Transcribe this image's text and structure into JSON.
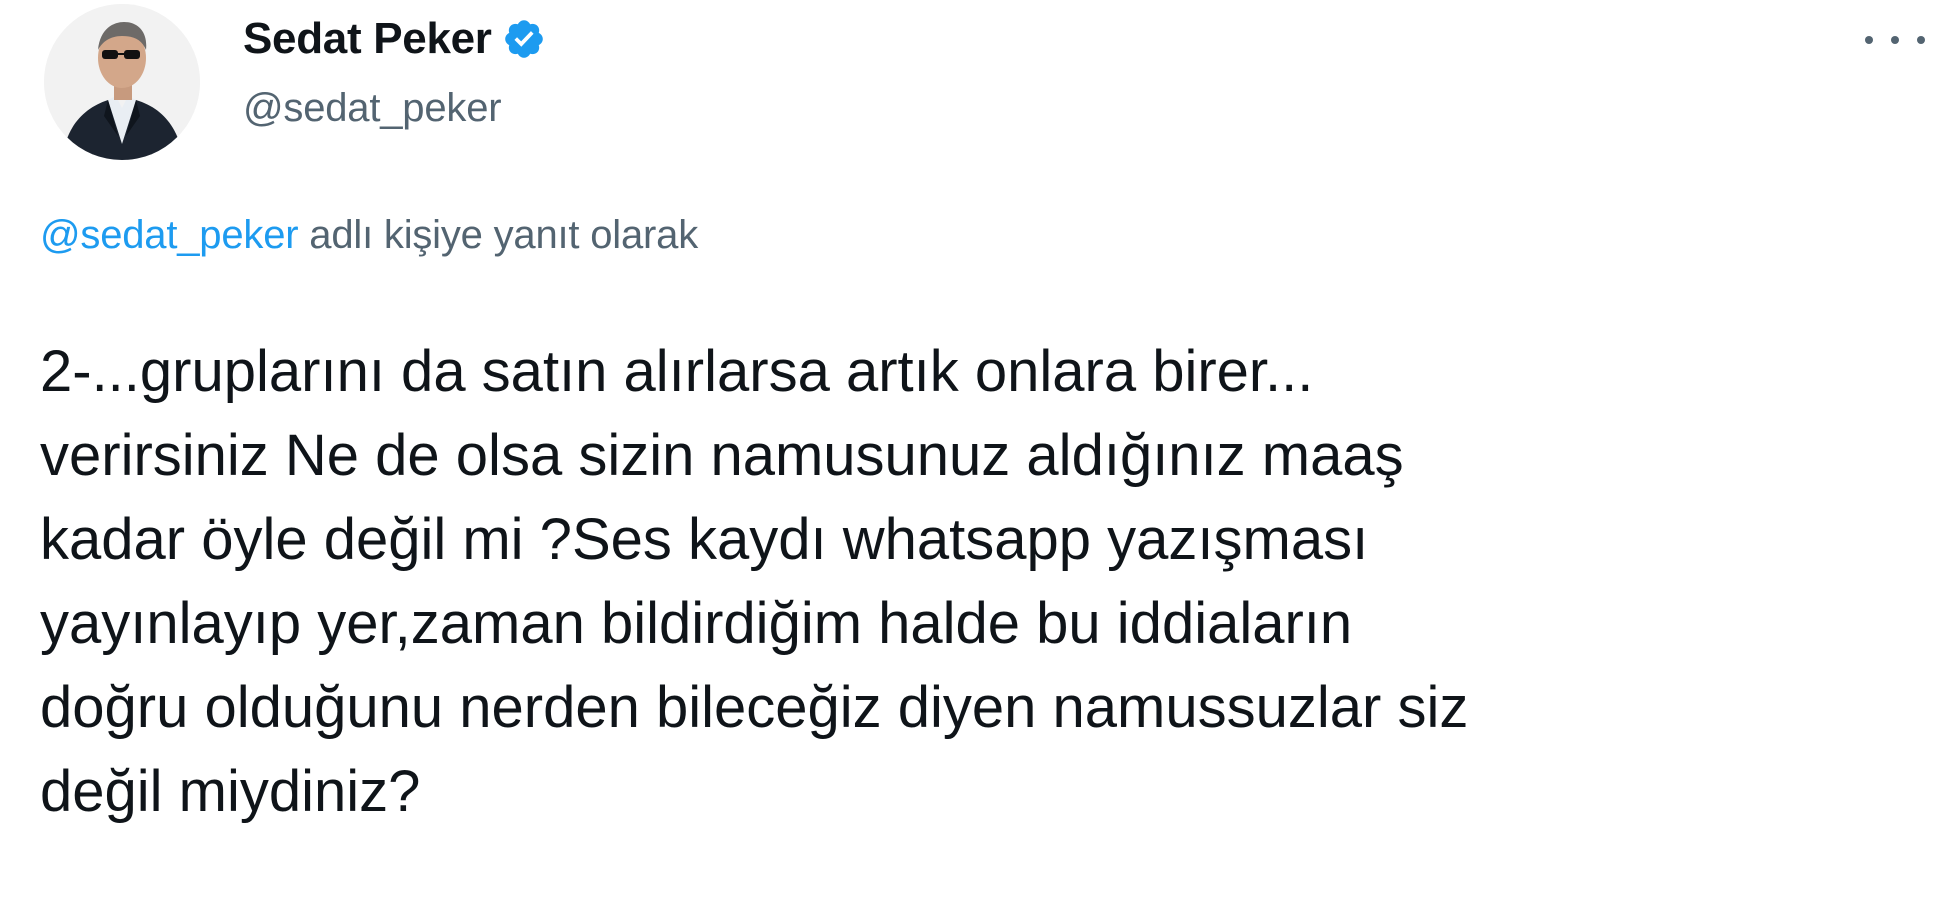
{
  "author": {
    "display_name": "Sedat Peker",
    "handle": "@sedat_peker",
    "verified_icon": "verified-badge-icon",
    "avatar_icon": "profile-photo"
  },
  "header": {
    "more_icon": "more-options-icon"
  },
  "reply_context": {
    "mention": "@sedat_peker",
    "suffix": " adlı kişiye yanıt olarak"
  },
  "tweet": {
    "lines": [
      "2-...gruplarını da satın alırlarsa artık onlara birer...",
      "verirsiniz Ne de olsa sizin namusunuz aldığınız maaş",
      "kadar öyle değil mi ?Ses kaydı whatsapp yazışması",
      "yayınlayıp yer,zaman bildirdiğim halde bu iddiaların",
      "doğru olduğunu nerden bileceğiz diyen namussuzlar siz",
      "değil miydiniz?"
    ]
  },
  "colors": {
    "text_primary": "#0f1419",
    "text_secondary": "#536471",
    "accent_blue": "#1d9bf0"
  }
}
